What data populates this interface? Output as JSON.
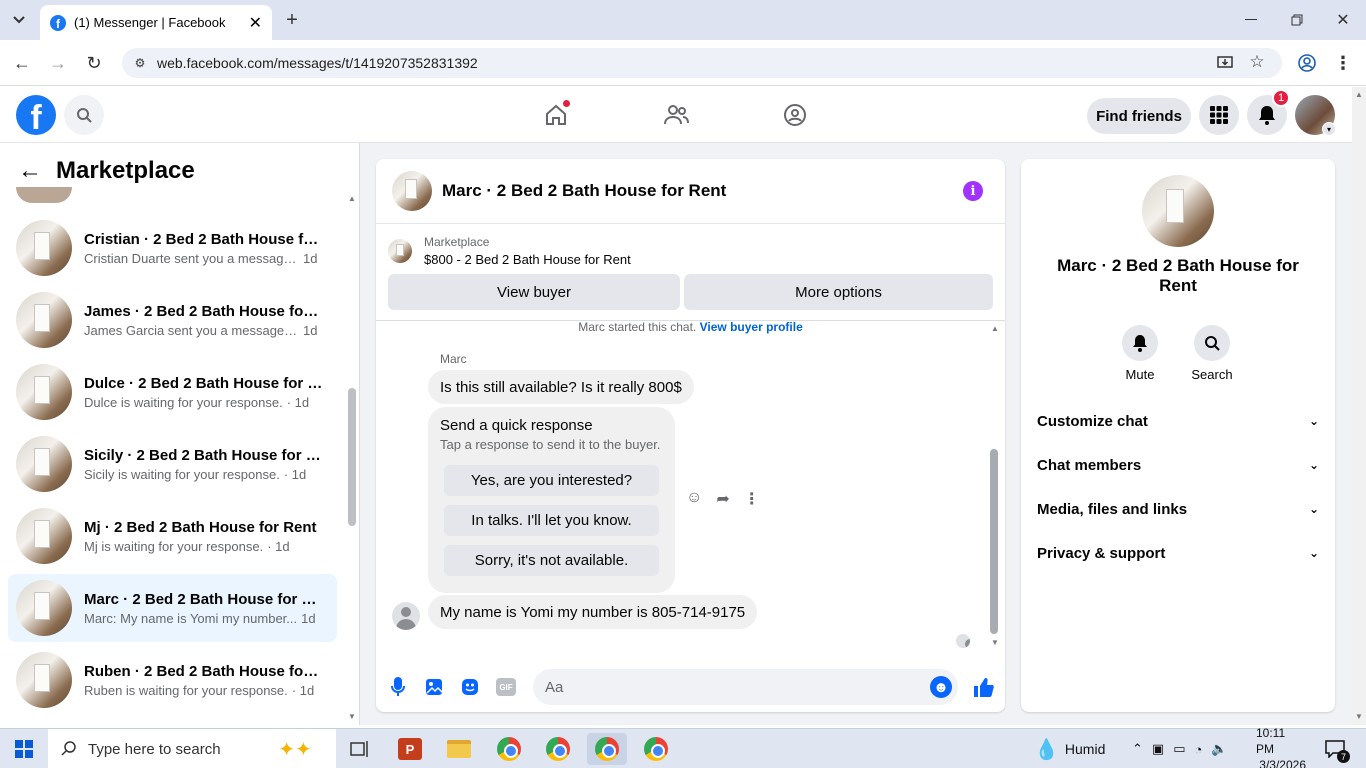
{
  "browser": {
    "tab_title": "(1) Messenger | Facebook",
    "url": "web.facebook.com/messages/t/1419207352831392"
  },
  "header": {
    "find_friends": "Find friends",
    "notification_count": "1"
  },
  "sidebar": {
    "title": "Marketplace",
    "conversations": [
      {
        "name": "Cristian · 2 Bed 2 Bath House for...",
        "preview": "Cristian Duarte sent you a message...",
        "time": "1d"
      },
      {
        "name": "James · 2 Bed 2 Bath House for ...",
        "preview": "James Garcia sent you a message a...",
        "time": "1d"
      },
      {
        "name": "Dulce · 2 Bed 2 Bath House for R...",
        "preview": "Dulce is waiting for your response.",
        "time": "· 1d"
      },
      {
        "name": "Sicily · 2 Bed 2 Bath House for R...",
        "preview": "Sicily is waiting for your response.",
        "time": "· 1d"
      },
      {
        "name": "Mj · 2 Bed 2 Bath House for Rent",
        "preview": "Mj is waiting for your response.",
        "time": "· 1d"
      },
      {
        "name": "Marc · 2 Bed 2 Bath House for R...",
        "preview": "Marc: My name is Yomi my number...",
        "time": "1d"
      },
      {
        "name": "Ruben · 2 Bed 2 Bath House for ...",
        "preview": "Ruben is waiting for your response.",
        "time": "· 1d"
      }
    ]
  },
  "chat": {
    "title": "Marc · 2 Bed 2 Bath House for Rent",
    "listing_source": "Marketplace",
    "listing": "$800 - 2 Bed 2 Bath House for Rent",
    "view_buyer": "View buyer",
    "more_options": "More options",
    "system_msg": "Marc started this chat.",
    "system_link": "View buyer profile",
    "sender": "Marc",
    "msg1": "Is this still available? Is it really 800$",
    "quick_title": "Send a quick response",
    "quick_sub": "Tap a response to send it to the buyer.",
    "quick_replies": [
      "Yes, are you interested?",
      "In talks. I'll let you know.",
      "Sorry, it's not available."
    ],
    "msg2": "My name is Yomi my number is 805-714-9175",
    "input_placeholder": "Aa",
    "gif_label": "GIF"
  },
  "info_panel": {
    "title": "Marc · 2 Bed 2 Bath House for Rent",
    "mute": "Mute",
    "search": "Search",
    "sections": [
      "Customize chat",
      "Chat members",
      "Media, files and links",
      "Privacy & support"
    ]
  },
  "taskbar": {
    "search_placeholder": "Type here to search",
    "weather": "Humid",
    "time": "10:11 PM",
    "date": "3/3/2026",
    "notif_count": "7"
  },
  "colors": {
    "fb_blue": "#1877f2",
    "accent_purple": "#a033ff",
    "selected_bg": "#ebf5ff"
  }
}
